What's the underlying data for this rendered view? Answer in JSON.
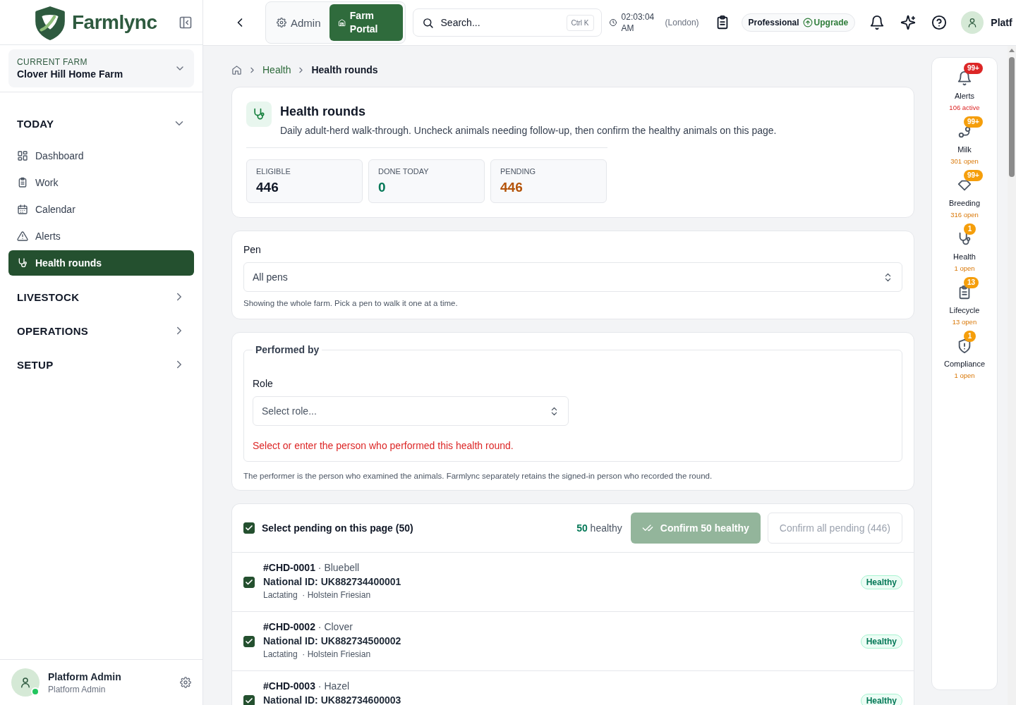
{
  "brand": {
    "name": "Farmlync"
  },
  "current_farm": {
    "label": "CURRENT FARM",
    "name": "Clover Hill Home Farm"
  },
  "nav": [
    {
      "label": "TODAY",
      "expanded": true,
      "children": [
        {
          "label": "Dashboard",
          "selected": false
        },
        {
          "label": "Work",
          "selected": false
        },
        {
          "label": "Calendar",
          "selected": false
        },
        {
          "label": "Alerts",
          "selected": false
        },
        {
          "label": "Health rounds",
          "selected": true
        }
      ]
    },
    {
      "label": "LIVESTOCK",
      "expanded": false
    },
    {
      "label": "OPERATIONS",
      "expanded": false
    },
    {
      "label": "SETUP",
      "expanded": false
    }
  ],
  "user": {
    "name": "Platform Admin",
    "role": "Platform Admin",
    "online": true
  },
  "topbar": {
    "portal_tabs": [
      {
        "label": "Admin",
        "selected": false
      },
      {
        "label": "Farm Portal",
        "selected": true
      }
    ],
    "search": {
      "placeholder": "Search...",
      "shortcut": "Ctrl K"
    },
    "clock": {
      "time": "02:03:04 AM",
      "zone": "(London)"
    },
    "plan": {
      "name": "Professional",
      "action": "Upgrade"
    },
    "user_name": "Platf"
  },
  "breadcrumb": [
    "Health",
    "Health rounds"
  ],
  "header": {
    "title": "Health rounds",
    "description": "Daily adult-herd walk-through. Uncheck animals needing follow-up, then confirm the healthy animals on this page.",
    "stats": [
      {
        "label": "ELIGIBLE",
        "value": "446",
        "color": "#111827"
      },
      {
        "label": "DONE TODAY",
        "value": "0",
        "color": "#047857"
      },
      {
        "label": "PENDING",
        "value": "446",
        "color": "#b45309"
      }
    ]
  },
  "pen": {
    "label": "Pen",
    "value": "All pens",
    "hint": "Showing the whole farm. Pick a pen to walk it one at a time."
  },
  "performed_by": {
    "legend": "Performed by",
    "role_label": "Role",
    "role_placeholder": "Select role...",
    "error": "Select or enter the person who performed this health round.",
    "note": "The performer is the person who examined the animals. Farmlync separately retains the signed-in person who recorded the round."
  },
  "selection": {
    "checked": true,
    "label": "Select pending on this page (50)",
    "count": "50",
    "count_label": "healthy",
    "confirm": "Confirm 50 healthy",
    "confirm_all": "Confirm all pending (446)"
  },
  "animals": [
    {
      "title": "**#CHD-0001** · Bluebell",
      "national_id": "National ID: UK882734400001",
      "details": "Lactating  · Holstein Friesian",
      "checked": true,
      "badge": "Healthy"
    },
    {
      "title": "**#CHD-0002** · Clover",
      "national_id": "National ID: UK882734500002",
      "details": "Lactating  · Holstein Friesian",
      "checked": true,
      "badge": "Healthy"
    },
    {
      "title": "**#CHD-0003** · Hazel",
      "national_id": "National ID: UK882734600003",
      "checked": true,
      "badge": "Healthy"
    }
  ],
  "rail": [
    {
      "label": "Alerts",
      "count": "99+",
      "sub": "106 active",
      "color": "#dc2626"
    },
    {
      "label": "Milk",
      "count": "99+",
      "sub": "301 open",
      "color": "#f59e0b"
    },
    {
      "label": "Breeding",
      "count": "99+",
      "sub": "316 open",
      "color": "#f59e0b"
    },
    {
      "label": "Health",
      "count": "1",
      "sub": "1 open",
      "color": "#f59e0b"
    },
    {
      "label": "Lifecycle",
      "count": "13",
      "sub": "13 open",
      "color": "#f59e0b"
    },
    {
      "label": "Compliance",
      "count": "1",
      "sub": "1 open",
      "color": "#f59e0b"
    }
  ]
}
